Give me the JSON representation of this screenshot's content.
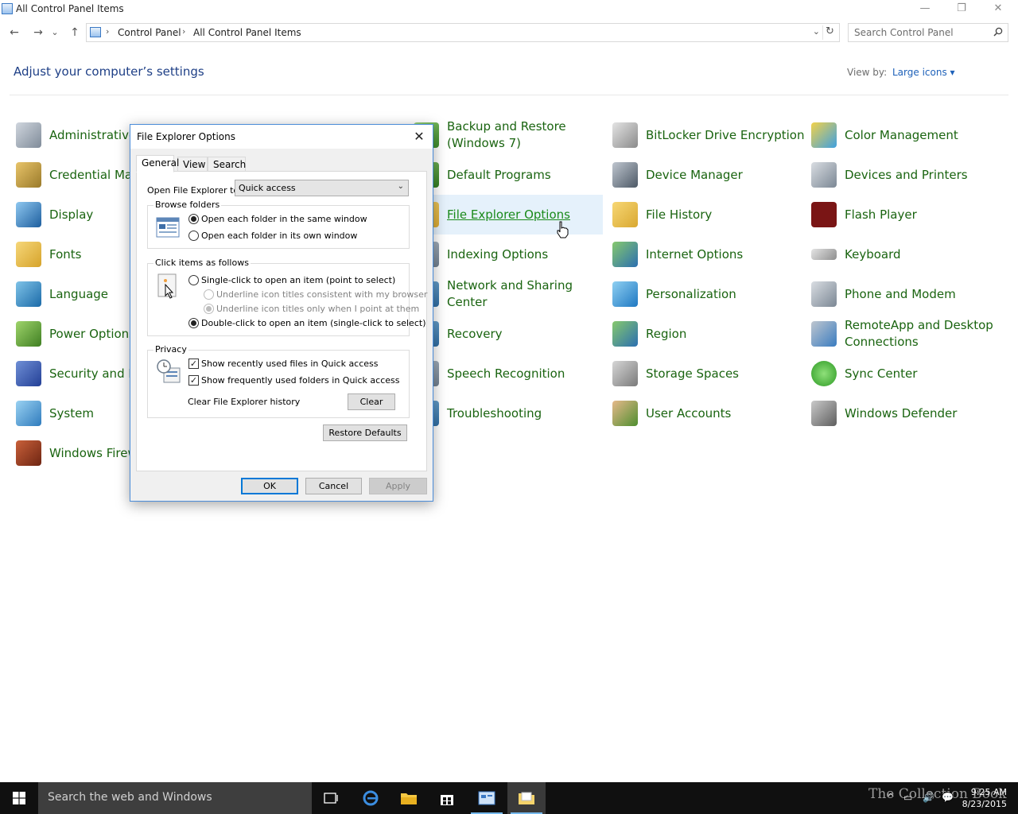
{
  "window": {
    "title": "All Control Panel Items",
    "minimize_glyph": "—",
    "restore_glyph": "❐",
    "close_glyph": "✕"
  },
  "nav": {
    "back_glyph": "←",
    "forward_glyph": "→",
    "recent_glyph": "⌄",
    "up_glyph": "↑",
    "breadcrumb": [
      "Control Panel",
      "All Control Panel Items"
    ],
    "separator": "›",
    "dropdown_glyph": "⌄",
    "refresh_glyph": "↻",
    "search_placeholder": "Search Control Panel"
  },
  "header": {
    "title": "Adjust your computer’s settings",
    "view_by_label": "View by:",
    "view_by_value": "Large icons ▾"
  },
  "items": {
    "col1": [
      "Administrative Tools",
      "Credential Manager",
      "Display",
      "Fonts",
      "Language",
      "Power Options",
      "Security and Maintenance",
      "System",
      "Windows Firewall"
    ],
    "col3": [
      "Backup and Restore (Windows 7)",
      "Default Programs",
      "File Explorer Options",
      "Indexing Options",
      "Network and Sharing Center",
      "Recovery",
      "Speech Recognition",
      "Troubleshooting"
    ],
    "col4": [
      "BitLocker Drive Encryption",
      "Device Manager",
      "File History",
      "Internet Options",
      "Personalization",
      "Region",
      "Storage Spaces",
      "User Accounts"
    ],
    "col5": [
      "Color Management",
      "Devices and Printers",
      "Flash Player",
      "Keyboard",
      "Phone and Modem",
      "RemoteApp and Desktop Connections",
      "Sync Center",
      "Windows Defender"
    ]
  },
  "colors": {
    "link_green": "#1a6410",
    "heading_blue": "#1e3f86",
    "hover_bg": "#e5f1fb",
    "accent": "#0078d7"
  },
  "dialog": {
    "title": "File Explorer Options",
    "close_glyph": "✕",
    "tabs": [
      "General",
      "View",
      "Search"
    ],
    "open_to_label": "Open File Explorer to:",
    "open_to_value": "Quick access",
    "combo_arrow": "⌄",
    "browse": {
      "title": "Browse folders",
      "opt1": "Open each folder in the same window",
      "opt2": "Open each folder in its own window"
    },
    "click": {
      "title": "Click items as follows",
      "single": "Single-click to open an item (point to select)",
      "sub1": "Underline icon titles consistent with my browser",
      "sub2": "Underline icon titles only when I point at them",
      "double": "Double-click to open an item (single-click to select)"
    },
    "privacy": {
      "title": "Privacy",
      "recent_files": "Show recently used files in Quick access",
      "frequent_folders": "Show frequently used folders in Quick access",
      "clear_history_label": "Clear File Explorer history",
      "clear_button": "Clear"
    },
    "check_glyph": "✓",
    "restore_defaults": "Restore Defaults",
    "ok": "OK",
    "cancel": "Cancel",
    "apply": "Apply"
  },
  "taskbar": {
    "search_placeholder": "Search the web and Windows",
    "watermark": "The Collection Book",
    "time": "9:25 AM",
    "date": "8/23/2015",
    "tray_glyphs": [
      "^",
      "▭",
      "🔊",
      "💬"
    ]
  }
}
